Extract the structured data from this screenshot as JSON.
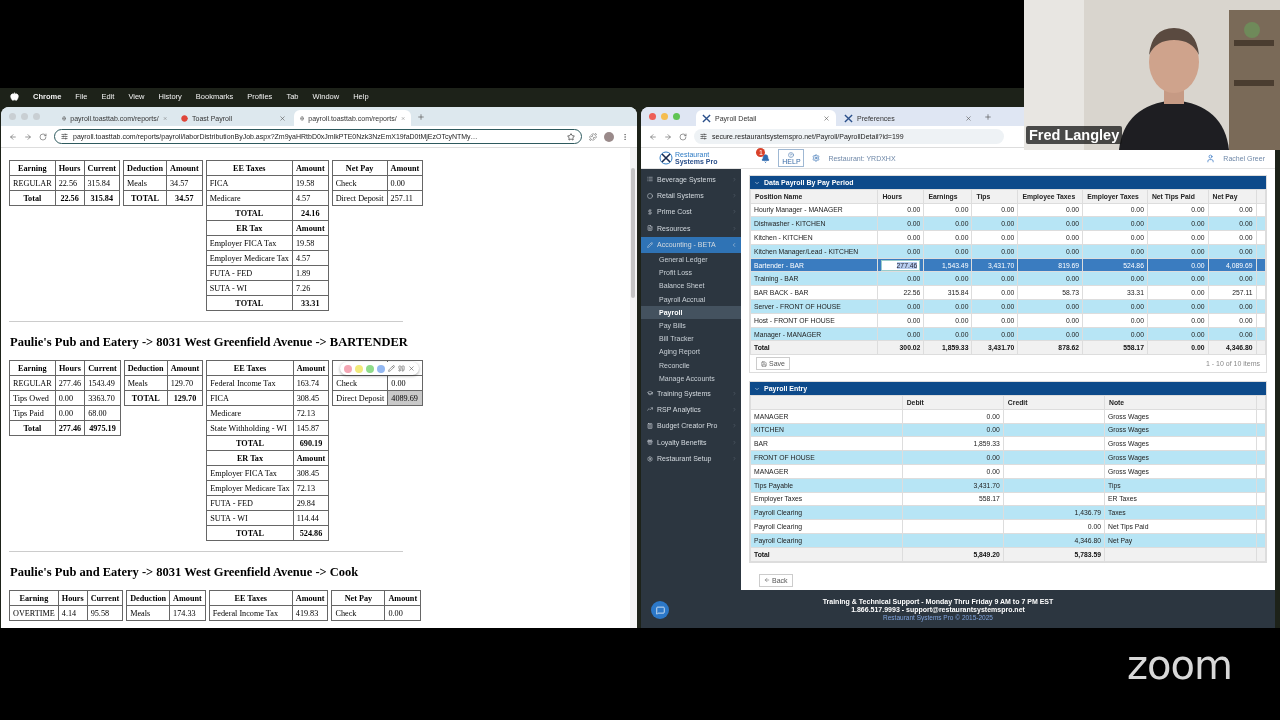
{
  "screen_share": {
    "menu_bar": {
      "app": "Chrome",
      "items": [
        "File",
        "Edit",
        "View",
        "History",
        "Bookmarks",
        "Profiles",
        "Tab",
        "Window",
        "Help"
      ]
    },
    "left_window": {
      "tabs": [
        {
          "title": "payroll.toasttab.com/reports/",
          "selected": false
        },
        {
          "title": "Toast Payroll",
          "selected": false
        },
        {
          "title": "payroll.toasttab.com/reports/",
          "selected": true
        }
      ],
      "url": "payroll.toasttab.com/reports/payroll/laborDistributionByJob.aspx?Zm9yaHRtbD0xJmlkPTE0Nzk3NzEmX19faD0tMjEzOTcyNTMy…",
      "sections": [
        {
          "tables": [
            {
              "kind": "earning",
              "rows": [
                {
                  "kind": "head",
                  "cells": [
                    "Earning",
                    "Hours",
                    "Current"
                  ]
                },
                {
                  "kind": "data",
                  "cells": [
                    "REGULAR",
                    "22.56",
                    "315.84"
                  ]
                },
                {
                  "kind": "total",
                  "cells": [
                    "Total",
                    "22.56",
                    "315.84"
                  ]
                }
              ]
            },
            {
              "kind": "deduction",
              "rows": [
                {
                  "kind": "head",
                  "cells": [
                    "Deduction",
                    "Amount"
                  ]
                },
                {
                  "kind": "data",
                  "cells": [
                    "Meals",
                    "34.57"
                  ]
                },
                {
                  "kind": "total",
                  "cells": [
                    "TOTAL",
                    "34.57"
                  ]
                }
              ]
            },
            {
              "kind": "taxes",
              "rows": [
                {
                  "kind": "head",
                  "cells": [
                    "EE Taxes",
                    "Amount"
                  ]
                },
                {
                  "kind": "data",
                  "cells": [
                    "FICA",
                    "19.58"
                  ]
                },
                {
                  "kind": "data",
                  "cells": [
                    "Medicare",
                    "4.57"
                  ]
                },
                {
                  "kind": "total",
                  "cells": [
                    "TOTAL",
                    "24.16"
                  ]
                },
                {
                  "kind": "head",
                  "cells": [
                    "ER Tax",
                    "Amount"
                  ]
                },
                {
                  "kind": "data",
                  "cells": [
                    "Employer FICA Tax",
                    "19.58"
                  ]
                },
                {
                  "kind": "data",
                  "cells": [
                    "Employer Medicare Tax",
                    "4.57"
                  ]
                },
                {
                  "kind": "data",
                  "cells": [
                    "FUTA - FED",
                    "1.89"
                  ]
                },
                {
                  "kind": "data",
                  "cells": [
                    "SUTA - WI",
                    "7.26"
                  ]
                },
                {
                  "kind": "total",
                  "cells": [
                    "TOTAL",
                    "33.31"
                  ]
                }
              ]
            },
            {
              "kind": "netpay",
              "rows": [
                {
                  "kind": "head",
                  "cells": [
                    "Net Pay",
                    "Amount"
                  ]
                },
                {
                  "kind": "data",
                  "cells": [
                    "Check",
                    "0.00"
                  ]
                },
                {
                  "kind": "data",
                  "cells": [
                    "Direct Deposit",
                    "257.11"
                  ]
                }
              ]
            }
          ]
        },
        {
          "heading": "Paulie's Pub and Eatery -> 8031 West Greenfield Avenue -> BARTENDER",
          "tables": [
            {
              "kind": "earning",
              "rows": [
                {
                  "kind": "head",
                  "cells": [
                    "Earning",
                    "Hours",
                    "Current"
                  ]
                },
                {
                  "kind": "data",
                  "cells": [
                    "REGULAR",
                    "277.46",
                    "1543.49"
                  ]
                },
                {
                  "kind": "data",
                  "cells": [
                    "Tips Owed",
                    "0.00",
                    "3363.70"
                  ]
                },
                {
                  "kind": "data",
                  "cells": [
                    "Tips Paid",
                    "0.00",
                    "68.00"
                  ]
                },
                {
                  "kind": "total",
                  "cells": [
                    "Total",
                    "277.46",
                    "4975.19"
                  ]
                }
              ]
            },
            {
              "kind": "deduction",
              "rows": [
                {
                  "kind": "head",
                  "cells": [
                    "Deduction",
                    "Amount"
                  ]
                },
                {
                  "kind": "data",
                  "cells": [
                    "Meals",
                    "129.70"
                  ]
                },
                {
                  "kind": "total",
                  "cells": [
                    "TOTAL",
                    "129.70"
                  ]
                }
              ]
            },
            {
              "kind": "taxes",
              "rows": [
                {
                  "kind": "head",
                  "cells": [
                    "EE Taxes",
                    "Amount"
                  ]
                },
                {
                  "kind": "data",
                  "cells": [
                    "Federal Income Tax",
                    "163.74"
                  ]
                },
                {
                  "kind": "data",
                  "cells": [
                    "FICA",
                    "308.45"
                  ]
                },
                {
                  "kind": "data",
                  "cells": [
                    "Medicare",
                    "72.13"
                  ]
                },
                {
                  "kind": "data",
                  "cells": [
                    "State Withholding - WI",
                    "145.87"
                  ]
                },
                {
                  "kind": "total",
                  "cells": [
                    "TOTAL",
                    "690.19"
                  ]
                },
                {
                  "kind": "head",
                  "cells": [
                    "ER Tax",
                    "Amount"
                  ]
                },
                {
                  "kind": "data",
                  "cells": [
                    "Employer FICA Tax",
                    "308.45"
                  ]
                },
                {
                  "kind": "data",
                  "cells": [
                    "Employer Medicare Tax",
                    "72.13"
                  ]
                },
                {
                  "kind": "data",
                  "cells": [
                    "FUTA - FED",
                    "29.84"
                  ]
                },
                {
                  "kind": "data",
                  "cells": [
                    "SUTA - WI",
                    "114.44"
                  ]
                },
                {
                  "kind": "total",
                  "cells": [
                    "TOTAL",
                    "524.86"
                  ]
                }
              ]
            },
            {
              "kind": "netpay",
              "highlighter": true,
              "rows": [
                {
                  "kind": "head",
                  "cells": [
                    null,
                    null
                  ]
                },
                {
                  "kind": "data",
                  "cells": [
                    "Check",
                    "0.00"
                  ]
                },
                {
                  "kind": "data",
                  "cells": [
                    "Direct Deposit",
                    "4089.69"
                  ],
                  "highlighted": true
                }
              ]
            }
          ]
        },
        {
          "heading": "Paulie's Pub and Eatery -> 8031 West Greenfield Avenue -> Cook",
          "tables": [
            {
              "kind": "earning",
              "rows": [
                {
                  "kind": "head",
                  "cells": [
                    "Earning",
                    "Hours",
                    "Current"
                  ]
                },
                {
                  "kind": "data",
                  "cells": [
                    "OVERTIME",
                    "4.14",
                    "95.58"
                  ]
                }
              ]
            },
            {
              "kind": "deduction",
              "rows": [
                {
                  "kind": "head",
                  "cells": [
                    "Deduction",
                    "Amount"
                  ]
                },
                {
                  "kind": "data",
                  "cells": [
                    "Meals",
                    "174.33"
                  ]
                }
              ]
            },
            {
              "kind": "taxes",
              "rows": [
                {
                  "kind": "head",
                  "cells": [
                    "EE Taxes",
                    "Amount"
                  ]
                },
                {
                  "kind": "data",
                  "cells": [
                    "Federal Income Tax",
                    "419.83"
                  ]
                }
              ]
            },
            {
              "kind": "netpay",
              "rows": [
                {
                  "kind": "head",
                  "cells": [
                    "Net Pay",
                    "Amount"
                  ]
                },
                {
                  "kind": "data",
                  "cells": [
                    "Check",
                    "0.00"
                  ]
                }
              ]
            }
          ]
        }
      ],
      "highlighter_colors": [
        {
          "color": "#f4a6b4"
        },
        {
          "color": "#f2ea7a"
        },
        {
          "color": "#8fdc8a"
        },
        {
          "color": "#93b8f2"
        }
      ]
    },
    "right_window": {
      "tabs": [
        {
          "title": "Payroll Detail",
          "selected": true
        },
        {
          "title": "Preferences",
          "selected": false
        }
      ],
      "url": "secure.restaurantsystemspro.net/Payroll/PayrollDetail?id=199",
      "app": {
        "logo": [
          "Restaurant",
          "Systems Pro"
        ],
        "notification_count": "1",
        "help": "HELP",
        "restaurant": "Restaurant: YRDXHX",
        "user": "Rachel Greer",
        "sidebar": [
          {
            "label": "Beverage Systems",
            "selected": false,
            "expanded": false
          },
          {
            "label": "Retail Systems",
            "selected": false,
            "expanded": false
          },
          {
            "label": "Prime Cost",
            "selected": false,
            "expanded": false
          },
          {
            "label": "Resources",
            "selected": false,
            "expanded": false
          },
          {
            "label": "Accounting - BETA",
            "selected": true,
            "expanded": true,
            "children": [
              {
                "label": "General Ledger",
                "selected": false
              },
              {
                "label": "Profit Loss",
                "selected": false
              },
              {
                "label": "Balance Sheet",
                "selected": false
              },
              {
                "label": "Payroll Accrual",
                "selected": false
              },
              {
                "label": "Payroll",
                "selected": true
              },
              {
                "label": "Pay Bills",
                "selected": false
              },
              {
                "label": "Bill Tracker",
                "selected": false
              },
              {
                "label": "Aging Report",
                "selected": false
              },
              {
                "label": "Reconcile",
                "selected": false
              },
              {
                "label": "Manage Accounts",
                "selected": false
              }
            ]
          },
          {
            "label": "Training Systems",
            "selected": false,
            "expanded": false
          },
          {
            "label": "RSP Analytics",
            "selected": false,
            "expanded": false
          },
          {
            "label": "Budget Creator Pro",
            "selected": false,
            "expanded": false
          },
          {
            "label": "Loyalty Benefits",
            "selected": false,
            "expanded": false
          },
          {
            "label": "Restaurant Setup",
            "selected": false,
            "expanded": false
          }
        ],
        "pay_period_panel": {
          "title": "Data Payroll By Pay Period",
          "columns": [
            "Position Name",
            "Hours",
            "Earnings",
            "Tips",
            "Employee Taxes",
            "Employer Taxes",
            "Net Tips Paid",
            "Net Pay"
          ],
          "rows": [
            {
              "cells": [
                "Hourly Manager - MANAGER",
                "0.00",
                "0.00",
                "0.00",
                "0.00",
                "0.00",
                "0.00",
                "0.00"
              ],
              "selected": false
            },
            {
              "cells": [
                "Dishwasher - KITCHEN",
                "0.00",
                "0.00",
                "0.00",
                "0.00",
                "0.00",
                "0.00",
                "0.00"
              ],
              "selected": false
            },
            {
              "cells": [
                "Kitchen - KITCHEN",
                "0.00",
                "0.00",
                "0.00",
                "0.00",
                "0.00",
                "0.00",
                "0.00"
              ],
              "selected": false
            },
            {
              "cells": [
                "Kitchen Manager/Lead - KITCHEN",
                "0.00",
                "0.00",
                "0.00",
                "0.00",
                "0.00",
                "0.00",
                "0.00"
              ],
              "selected": false
            },
            {
              "cells": [
                "Bartender - BAR",
                "277.46",
                "1,543.49",
                "3,431.70",
                "819.69",
                "524.86",
                "0.00",
                "4,089.69"
              ],
              "selected": true
            },
            {
              "cells": [
                "Training - BAR",
                "0.00",
                "0.00",
                "0.00",
                "0.00",
                "0.00",
                "0.00",
                "0.00"
              ],
              "selected": false
            },
            {
              "cells": [
                "BAR BACK - BAR",
                "22.56",
                "315.84",
                "0.00",
                "58.73",
                "33.31",
                "0.00",
                "257.11"
              ],
              "selected": false
            },
            {
              "cells": [
                "Server - FRONT OF HOUSE",
                "0.00",
                "0.00",
                "0.00",
                "0.00",
                "0.00",
                "0.00",
                "0.00"
              ],
              "selected": false
            },
            {
              "cells": [
                "Host - FRONT OF HOUSE",
                "0.00",
                "0.00",
                "0.00",
                "0.00",
                "0.00",
                "0.00",
                "0.00"
              ],
              "selected": false
            },
            {
              "cells": [
                "Manager - MANAGER",
                "0.00",
                "0.00",
                "0.00",
                "0.00",
                "0.00",
                "0.00",
                "0.00"
              ],
              "selected": false
            }
          ],
          "total": [
            "Total",
            "300.02",
            "1,859.33",
            "3,431.70",
            "878.62",
            "558.17",
            "0.00",
            "4,346.80"
          ],
          "save": "Save",
          "pager": "1 - 10 of 10 items"
        },
        "entry_panel": {
          "title": "Payroll Entry",
          "columns": [
            null,
            "Debit",
            "Credit",
            "Note"
          ],
          "rows": [
            [
              "MANAGER",
              "0.00",
              null,
              "Gross Wages"
            ],
            [
              "KITCHEN",
              "0.00",
              null,
              "Gross Wages"
            ],
            [
              "BAR",
              "1,859.33",
              null,
              "Gross Wages"
            ],
            [
              "FRONT OF HOUSE",
              "0.00",
              null,
              "Gross Wages"
            ],
            [
              "MANAGER",
              "0.00",
              null,
              "Gross Wages"
            ],
            [
              "Tips Payable",
              "3,431.70",
              null,
              "Tips"
            ],
            [
              "Employer Taxes",
              "558.17",
              null,
              "ER Taxes"
            ],
            [
              "Payroll Clearing",
              null,
              "1,436.79",
              "Taxes"
            ],
            [
              "Payroll Clearing",
              null,
              "0.00",
              "Net Tips Paid"
            ],
            [
              "Payroll Clearing",
              null,
              "4,346.80",
              "Net Pay"
            ]
          ],
          "total": [
            "Total",
            "5,849.20",
            "5,783.59"
          ]
        },
        "back": "Back",
        "footer": [
          "Training & Technical Support - Monday Thru Friday 9 AM to 7 PM EST",
          "1.866.517.9993 - support@restaurantsystemspro.net",
          "Restaurant Systems Pro © 2015-2025"
        ]
      }
    }
  },
  "video": {
    "name": "Fred Langley"
  },
  "zoom_logo": "zoom"
}
